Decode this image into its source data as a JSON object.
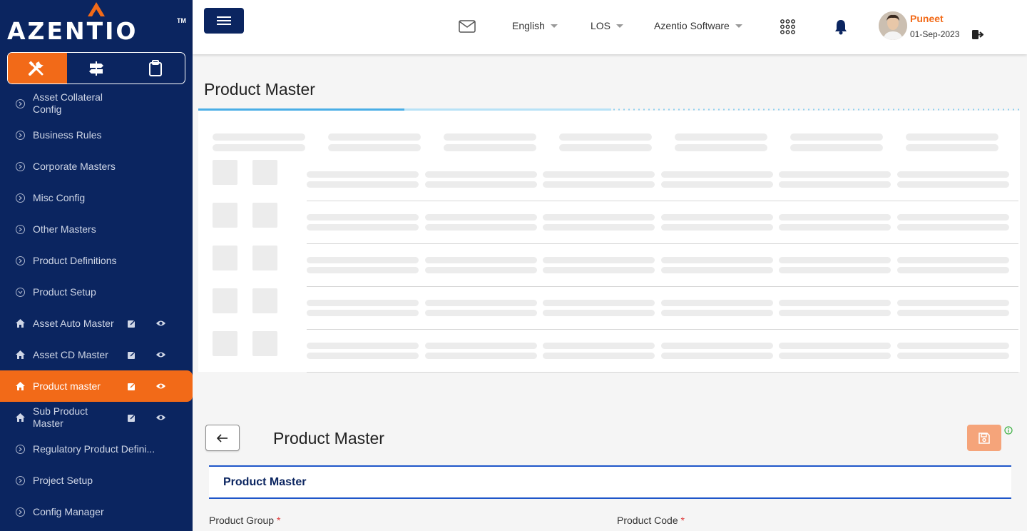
{
  "brand": {
    "name": "AZENTIO",
    "tm": "TM"
  },
  "sidebar": {
    "items": [
      {
        "label": "Asset Collateral Config"
      },
      {
        "label": "Business Rules"
      },
      {
        "label": "Corporate Masters"
      },
      {
        "label": "Misc Config"
      },
      {
        "label": "Other Masters"
      },
      {
        "label": "Product Definitions"
      },
      {
        "label": "Product Setup"
      },
      {
        "label": "Asset Auto Master"
      },
      {
        "label": "Asset CD Master"
      },
      {
        "label": "Product master"
      },
      {
        "label": "Sub Product Master"
      },
      {
        "label": "Regulatory Product Defini..."
      },
      {
        "label": "Project Setup"
      },
      {
        "label": "Config Manager"
      }
    ]
  },
  "topbar": {
    "language": "English",
    "module": "LOS",
    "company": "Azentio Software",
    "user_name": "Puneet",
    "date": "01-Sep-2023"
  },
  "page": {
    "title": "Product Master"
  },
  "form": {
    "title": "Product Master",
    "section_title": "Product Master",
    "fields": [
      {
        "label": "Product Group",
        "required": "*"
      },
      {
        "label": "Product Code",
        "required": "*"
      }
    ]
  },
  "colors": {
    "sidebar_bg": "#0b2560",
    "accent": "#f26a18",
    "section_border": "#1e56c9"
  }
}
